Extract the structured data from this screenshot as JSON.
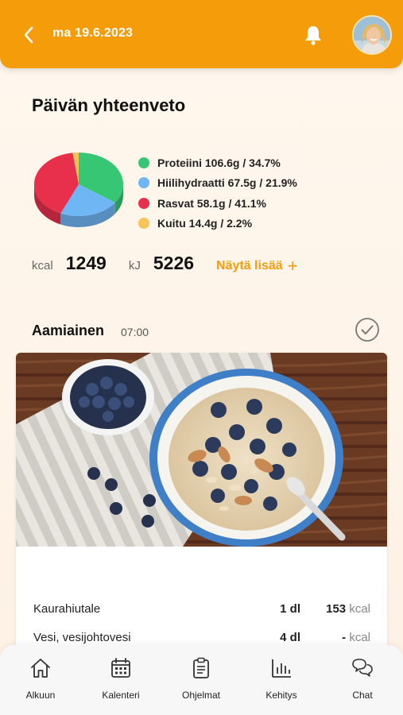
{
  "header": {
    "date": "ma 19.6.2023",
    "accent_color": "#f59c0b"
  },
  "summary": {
    "title": "Päivän yhteenveto",
    "legend": [
      {
        "label": "Proteiini 106.6g / 34.7%",
        "color": "#37c774"
      },
      {
        "label": "Hiilihydraatti 67.5g / 21.9%",
        "color": "#6fb6f5"
      },
      {
        "label": "Rasvat 58.1g / 41.1%",
        "color": "#e8304c"
      },
      {
        "label": "Kuitu 14.4g / 2.2%",
        "color": "#f6c55a"
      }
    ],
    "kcal_label": "kcal",
    "kcal_value": "1249",
    "kj_label": "kJ",
    "kj_value": "5226",
    "more_label": "Näytä lisää",
    "more_icon": "plus-icon"
  },
  "chart_data": {
    "type": "pie",
    "categories": [
      "Proteiini",
      "Hiilihydraatti",
      "Rasvat",
      "Kuitu"
    ],
    "values": [
      34.7,
      21.9,
      41.1,
      2.2
    ],
    "colors": [
      "#37c774",
      "#6fb6f5",
      "#e8304c",
      "#f6c55a"
    ]
  },
  "meal": {
    "title": "Aamiainen",
    "time": "07:00",
    "items": [
      {
        "name": "Kaurahiutale",
        "qty": "1 dl",
        "kcal_value": "153",
        "kcal_unit": "kcal"
      },
      {
        "name": "Vesi, vesijohtovesi",
        "qty": "4 dl",
        "kcal_value": "-",
        "kcal_unit": "kcal"
      }
    ]
  },
  "nav": {
    "items": [
      {
        "label": "Alkuun",
        "icon": "home-icon"
      },
      {
        "label": "Kalenteri",
        "icon": "calendar-icon"
      },
      {
        "label": "Ohjelmat",
        "icon": "clipboard-icon"
      },
      {
        "label": "Kehitys",
        "icon": "bar-chart-icon"
      },
      {
        "label": "Chat",
        "icon": "chat-icon"
      }
    ]
  }
}
